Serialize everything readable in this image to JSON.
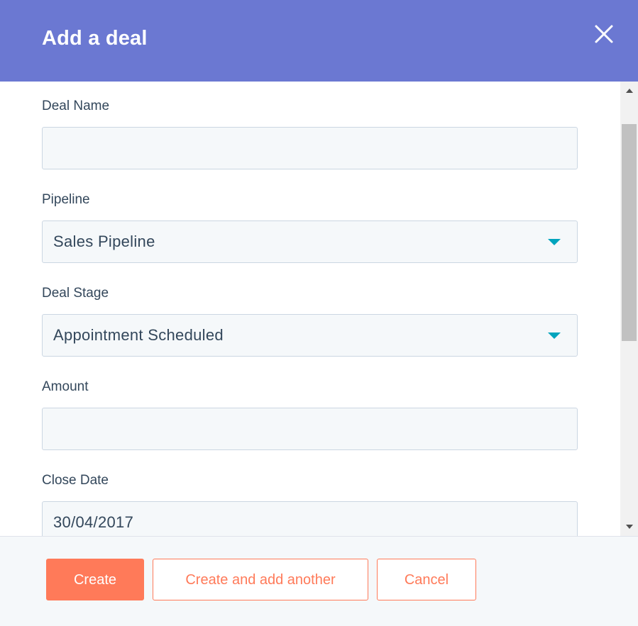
{
  "dialog": {
    "title": "Add a deal",
    "close_icon": "close-icon"
  },
  "fields": {
    "deal_name": {
      "label": "Deal Name",
      "value": ""
    },
    "pipeline": {
      "label": "Pipeline",
      "value": "Sales Pipeline"
    },
    "deal_stage": {
      "label": "Deal Stage",
      "value": "Appointment Scheduled"
    },
    "amount": {
      "label": "Amount",
      "value": ""
    },
    "close_date": {
      "label": "Close Date",
      "value": "30/04/2017"
    }
  },
  "footer": {
    "create_label": "Create",
    "create_another_label": "Create and add another",
    "cancel_label": "Cancel"
  },
  "colors": {
    "header_bg": "#6b78d2",
    "accent": "#ff7a59",
    "caret": "#00a4bd",
    "text": "#33475b"
  }
}
